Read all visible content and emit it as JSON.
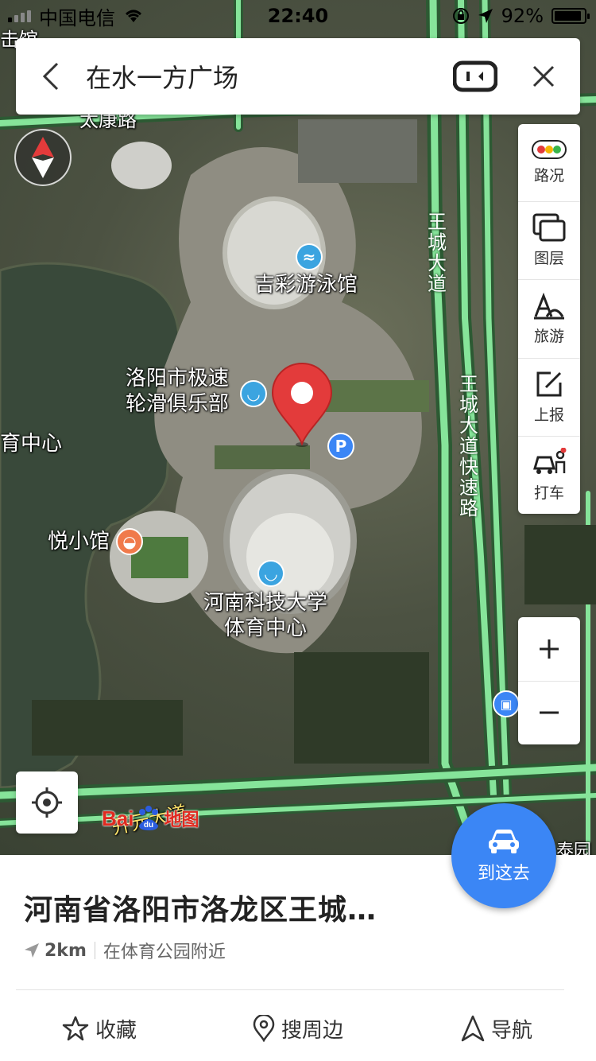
{
  "status_bar": {
    "carrier": "中国电信",
    "time": "22:40",
    "battery": "92%",
    "battery_level": 0.92
  },
  "search": {
    "query": "在水一方广场"
  },
  "map": {
    "labels": {
      "swimming_hall": "吉彩游泳馆",
      "skating_club_line1": "洛阳市极速",
      "skating_club_line2": "轮滑俱乐部",
      "sports_center_left": "育中心",
      "restaurant": "悦小馆",
      "university_line1": "河南科技大学",
      "university_line2": "体育中心",
      "road_top": "太康路",
      "road_left_top": "击馆",
      "road_bottom": "开元大道",
      "road_bottom_right": "泰园"
    },
    "road_names": {
      "wangcheng_avenue": [
        "王",
        "城",
        "大",
        "道"
      ],
      "wangcheng_expressway": [
        "王",
        "城",
        "大",
        "道",
        "快",
        "速",
        "路"
      ]
    },
    "watermark": "©Baidu"
  },
  "toolbar": {
    "items": [
      {
        "label": "路况",
        "icon": "traffic-light-icon"
      },
      {
        "label": "图层",
        "icon": "layers-icon"
      },
      {
        "label": "旅游",
        "icon": "tourism-icon"
      },
      {
        "label": "上报",
        "icon": "report-icon"
      },
      {
        "label": "打车",
        "icon": "taxi-icon"
      }
    ]
  },
  "logo": {
    "brand": "Bai",
    "paw": "du",
    "suffix": "地图"
  },
  "go_button": {
    "label": "到这去"
  },
  "place": {
    "title": "河南省洛阳市洛龙区王城…",
    "distance": "2km",
    "nearby": "在体育公园附近"
  },
  "actions": [
    {
      "label": "收藏",
      "icon": "star-icon"
    },
    {
      "label": "搜周边",
      "icon": "location-pin-icon"
    },
    {
      "label": "导航",
      "icon": "navigate-icon"
    }
  ],
  "colors": {
    "accent": "#3b86f5",
    "pin": "#e33b3b",
    "road": "#7ee39a"
  }
}
